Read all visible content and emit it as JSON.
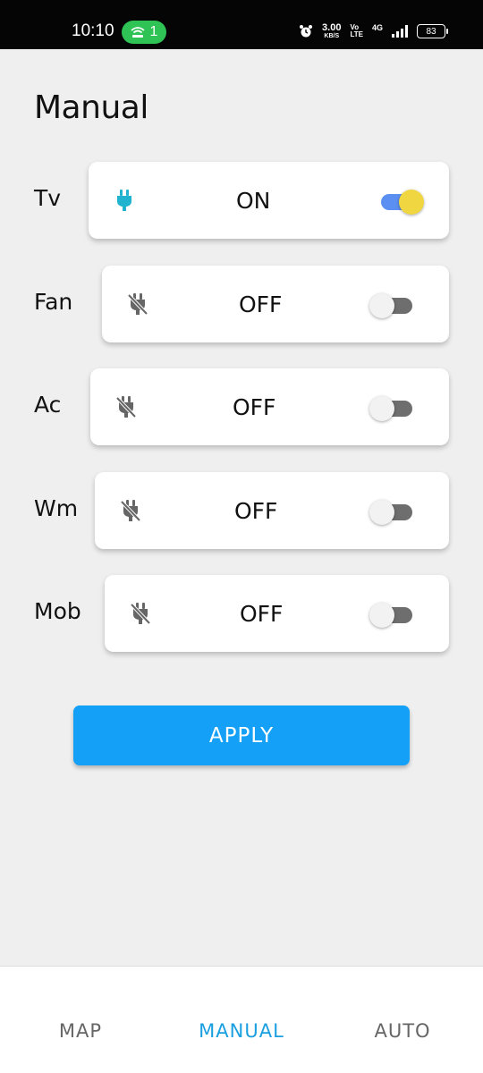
{
  "status_bar": {
    "time": "10:10",
    "hotspot_count": "1",
    "speed_value": "3.00",
    "speed_unit": "KB/S",
    "volte_top": "Vo",
    "volte_bottom": "LTE",
    "network": "4G",
    "battery": "83"
  },
  "page": {
    "title": "Manual"
  },
  "devices": [
    {
      "label": "Tv",
      "state": "ON",
      "on": true,
      "icon": "plug-icon"
    },
    {
      "label": "Fan",
      "state": "OFF",
      "on": false,
      "icon": "plug-off-icon"
    },
    {
      "label": "Ac",
      "state": "OFF",
      "on": false,
      "icon": "plug-off-icon"
    },
    {
      "label": "Wm",
      "state": "OFF",
      "on": false,
      "icon": "plug-off-icon"
    },
    {
      "label": "Mob",
      "state": "OFF",
      "on": false,
      "icon": "plug-off-icon"
    }
  ],
  "apply_label": "APPLY",
  "nav": {
    "items": [
      {
        "label": "MAP",
        "active": false
      },
      {
        "label": "MANUAL",
        "active": true
      },
      {
        "label": "AUTO",
        "active": false
      }
    ]
  },
  "colors": {
    "plug_on": "#1fb3cf",
    "plug_off": "#666666",
    "toggle_on_track": "#5b8ff2",
    "toggle_on_thumb": "#f0d641",
    "toggle_off_track": "#6e6e6e",
    "toggle_off_thumb": "#f2f2f2",
    "apply_bg": "#13a0f6",
    "nav_active": "#1a9fe0",
    "nav_inactive": "#666666"
  }
}
